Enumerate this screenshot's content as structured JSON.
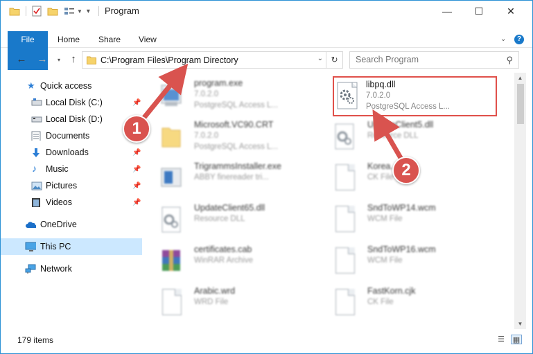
{
  "window": {
    "title": "Program",
    "controls": {
      "minimize": "—",
      "maximize": "☐",
      "close": "✕"
    }
  },
  "ribbon": {
    "tabs": [
      "File",
      "Home",
      "Share",
      "View"
    ]
  },
  "address": {
    "path": "C:\\Program Files\\Program Directory"
  },
  "search": {
    "placeholder": "Search Program"
  },
  "nav": {
    "items": [
      {
        "label": "Quick access",
        "icon": "star-icon"
      },
      {
        "label": "Local Disk (C:)",
        "icon": "drive-icon",
        "pinned": true
      },
      {
        "label": "Local Disk (D:)",
        "icon": "drive-icon"
      },
      {
        "label": "Documents",
        "icon": "documents-icon",
        "pinned": true
      },
      {
        "label": "Downloads",
        "icon": "download-icon",
        "pinned": true
      },
      {
        "label": "Music",
        "icon": "music-icon",
        "pinned": true
      },
      {
        "label": "Pictures",
        "icon": "pictures-icon",
        "pinned": true
      },
      {
        "label": "Videos",
        "icon": "videos-icon",
        "pinned": true
      },
      {
        "label": "OneDrive",
        "icon": "onedrive-icon"
      },
      {
        "label": "This PC",
        "icon": "computer-icon",
        "selected": true
      },
      {
        "label": "Network",
        "icon": "network-icon"
      }
    ]
  },
  "files": {
    "left": [
      {
        "name": "program.exe",
        "line2": "7.0.2.0",
        "line3": "PostgreSQL Access L..."
      },
      {
        "name": "Microsoft.VC90.CRT",
        "line2": "7.0.2.0",
        "line3": "PostgreSQL Access L..."
      },
      {
        "name": "TrigrammsInstaller.exe",
        "line2": "ABBY finereader tri...",
        "line3": ""
      },
      {
        "name": "UpdateClient65.dll",
        "line2": "Resource DLL",
        "line3": ""
      },
      {
        "name": "certificates.cab",
        "line2": "WinRAR Archive",
        "line3": ""
      },
      {
        "name": "Arabic.wrd",
        "line2": "WRD File",
        "line3": ""
      }
    ],
    "right": [
      {
        "name": "libpq.dll",
        "line2": "7.0.2.0",
        "line3": "PostgreSQL Access L...",
        "highlighted": true
      },
      {
        "name": "UpdateClient5.dll",
        "line2": "Resource DLL",
        "line3": ""
      },
      {
        "name": "Korea...",
        "line2": "CK File",
        "line3": ""
      },
      {
        "name": "SndToWP14.wcm",
        "line2": "WCM File",
        "line3": ""
      },
      {
        "name": "SndToWP16.wcm",
        "line2": "WCM File",
        "line3": ""
      },
      {
        "name": "FastKorn.cjk",
        "line2": "CK File",
        "line3": ""
      }
    ]
  },
  "status": {
    "item_count": "179 items"
  },
  "annotations": {
    "badge1": "1",
    "badge2": "2",
    "color": "#d9534f"
  }
}
